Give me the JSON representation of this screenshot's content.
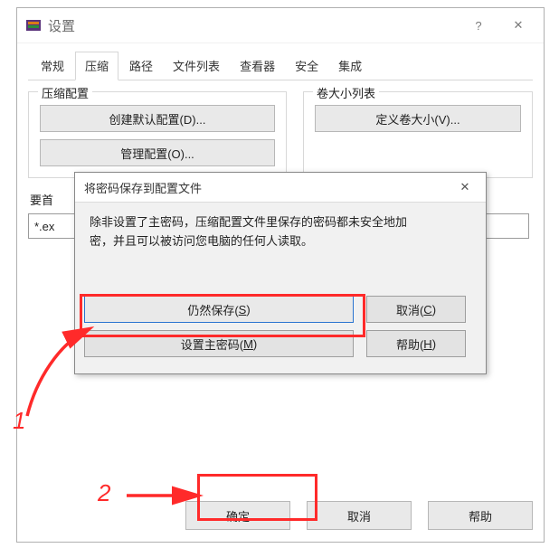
{
  "window": {
    "title": "设置",
    "help_glyph": "?",
    "close_glyph": "✕"
  },
  "tabs": [
    "常规",
    "压缩",
    "路径",
    "文件列表",
    "查看器",
    "安全",
    "集成"
  ],
  "active_tab_index": 1,
  "groups": {
    "compress": {
      "legend": "压缩配置",
      "btn_create": "创建默认配置(D)...",
      "btn_manage": "管理配置(O)..."
    },
    "volumes": {
      "legend": "卷大小列表",
      "btn_define": "定义卷大小(V)..."
    }
  },
  "priority_label": "要首",
  "priority_value": "*.ex",
  "bottom": {
    "ok": "确定",
    "cancel": "取消",
    "help": "帮助"
  },
  "modal": {
    "title": "将密码保存到配置文件",
    "close_glyph": "✕",
    "message_l1": "除非设置了主密码，压缩配置文件里保存的密码都未安全地加",
    "message_l2": "密，并且可以被访问您电脑的任何人读取。",
    "btn_save_pre": "仍然保存(",
    "btn_save_key": "S",
    "btn_save_post": ")",
    "btn_cancel_pre": "取消(",
    "btn_cancel_key": "C",
    "btn_cancel_post": ")",
    "btn_master_pre": "设置主密码(",
    "btn_master_key": "M",
    "btn_master_post": ")",
    "btn_help_pre": "帮助(",
    "btn_help_key": "H",
    "btn_help_post": ")"
  },
  "annotations": {
    "num1": "1",
    "num2": "2"
  }
}
